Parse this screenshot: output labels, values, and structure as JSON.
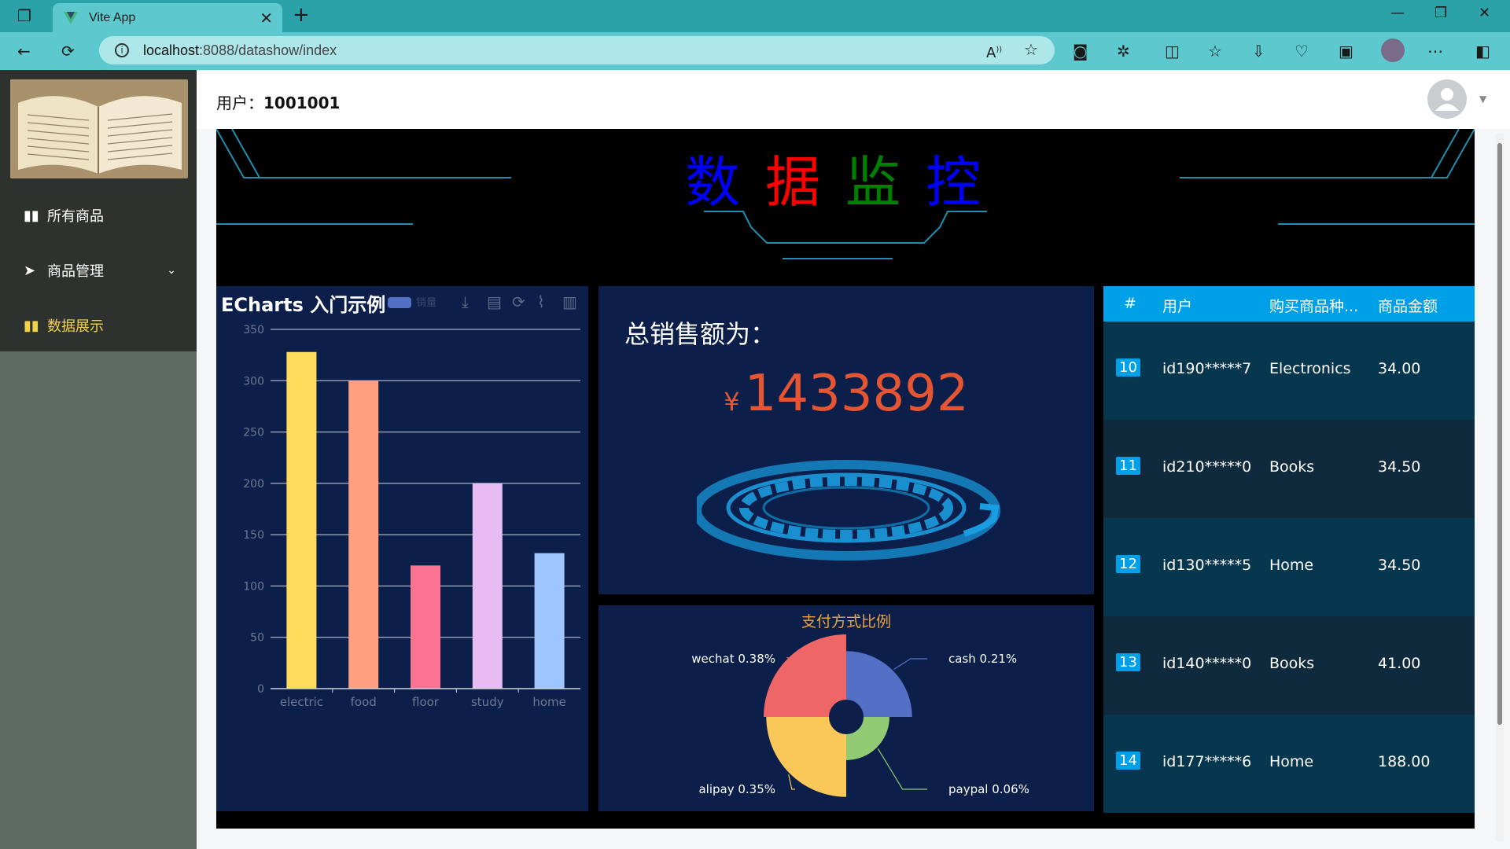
{
  "browser": {
    "tab_title": "Vite App",
    "url_host": "localhost",
    "url_rest": ":8088/datashow/index",
    "new_tab": "+",
    "tab_close": "✕"
  },
  "sidebar": {
    "items": [
      {
        "label": "所有商品",
        "icon": "book-icon"
      },
      {
        "label": "商品管理",
        "icon": "paper-plane-icon"
      },
      {
        "label": "数据展示",
        "icon": "book-icon"
      }
    ]
  },
  "header": {
    "user_label": "用户：",
    "user_id": "1001001"
  },
  "dashboard": {
    "title_chars": [
      "数",
      "据",
      "监",
      "控"
    ],
    "title_colors": [
      "#0000ff",
      "#ff0000",
      "#008000",
      "#0000ff"
    ]
  },
  "chart_panel": {
    "title": "ECharts 入门示例",
    "legend": "销量"
  },
  "chart_data": [
    {
      "type": "bar",
      "title": "ECharts 入门示例",
      "categories": [
        "electric",
        "food",
        "floor",
        "study",
        "home"
      ],
      "series": [
        {
          "name": "销量",
          "values": [
            328,
            300,
            120,
            200,
            132
          ]
        }
      ],
      "colors": [
        "#ffdb5c",
        "#ff9f7f",
        "#fb7293",
        "#e7bcf3",
        "#9fc5ff"
      ],
      "ylim": [
        0,
        350
      ],
      "yticks": [
        0,
        50,
        100,
        150,
        200,
        250,
        300,
        350
      ]
    },
    {
      "type": "pie",
      "title": "支付方式比例",
      "slices": [
        {
          "label": "wechat",
          "value": 0.38,
          "text": "wechat 0.38%",
          "color": "#ee6666"
        },
        {
          "label": "cash",
          "value": 0.21,
          "text": "cash 0.21%",
          "color": "#5470c6"
        },
        {
          "label": "paypal",
          "value": 0.06,
          "text": "paypal 0.06%",
          "color": "#91cc75"
        },
        {
          "label": "alipay",
          "value": 0.35,
          "text": "alipay 0.35%",
          "color": "#fac858"
        }
      ]
    }
  ],
  "total_panel": {
    "label": "总销售额为：",
    "currency": "¥",
    "amount": "1433892"
  },
  "pie_panel": {
    "title": "支付方式比例"
  },
  "table": {
    "headers": [
      "#",
      "用户",
      "购买商品种...",
      "商品金额"
    ],
    "rows": [
      {
        "idx": "10",
        "user": "id190*****7",
        "category": "Electronics",
        "amount": "34.00"
      },
      {
        "idx": "11",
        "user": "id210*****0",
        "category": "Books",
        "amount": "34.50"
      },
      {
        "idx": "12",
        "user": "id130*****5",
        "category": "Home",
        "amount": "34.50"
      },
      {
        "idx": "13",
        "user": "id140*****0",
        "category": "Books",
        "amount": "41.00"
      },
      {
        "idx": "14",
        "user": "id177*****6",
        "category": "Home",
        "amount": "188.00"
      }
    ],
    "row_colors": [
      "#07364f",
      "#0f2a3c"
    ]
  }
}
